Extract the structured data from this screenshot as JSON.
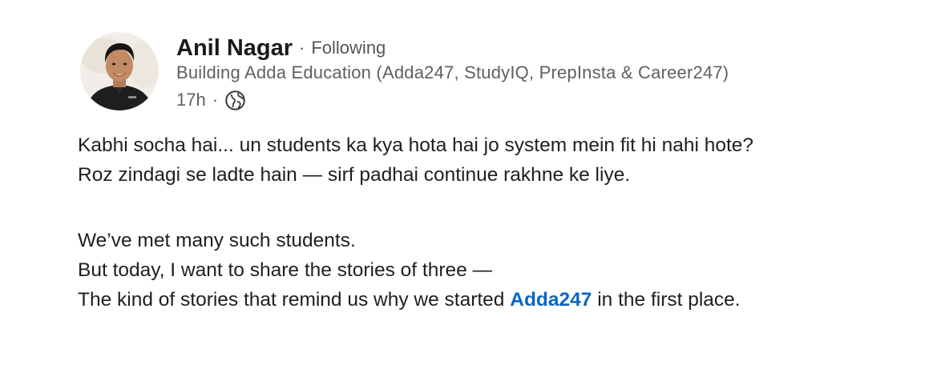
{
  "author": {
    "name": "Anil Nagar",
    "separator": "·",
    "follow_status": "Following",
    "headline": "Building Adda Education (Adda247, StudyIQ, PrepInsta & Career247)",
    "time": "17h",
    "meta_separator": "·",
    "visibility_icon": "globe-icon"
  },
  "post": {
    "lines": [
      "Kabhi socha hai... un students ka kya hota hai jo system mein fit hi nahi hote?",
      "Roz zindagi se ladte hain — sirf padhai continue rakhne ke liye.",
      "We’ve met many such students.",
      "But today, I want to share the stories of three —"
    ],
    "last_line_before": "The kind of stories that remind us why we started ",
    "link_text": "Adda247",
    "last_line_after": " in the first place."
  },
  "colors": {
    "link": "#0a66c2",
    "body_text": "#1f1f1f",
    "secondary_text": "#606060"
  }
}
